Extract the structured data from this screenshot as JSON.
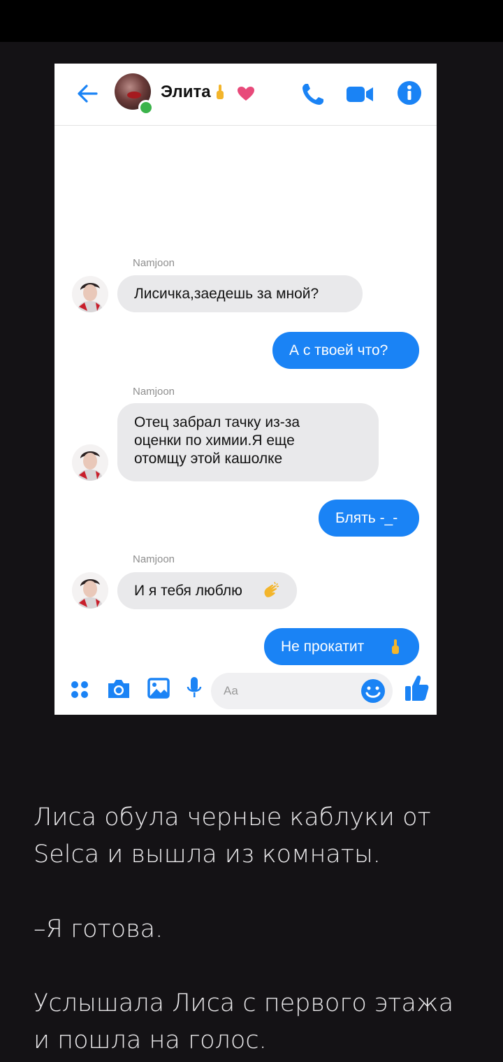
{
  "chat": {
    "contact_name": "Элита",
    "header_icons": [
      "back-arrow-icon",
      "middle-finger-emoji-icon",
      "heart-icon",
      "phone-icon",
      "video-camera-icon",
      "info-icon"
    ],
    "messages": [
      {
        "sender": "Namjoon",
        "text": "Лисичка,заедешь за мной?",
        "direction": "in"
      },
      {
        "text": "А с твоей что?",
        "direction": "out"
      },
      {
        "sender": "Namjoon",
        "lines": [
          "Отец забрал тачку из-за",
          "оценки по химии.Я еще",
          "отомщу этой кашолке"
        ],
        "direction": "in"
      },
      {
        "text": "Блять -_-",
        "direction": "out"
      },
      {
        "sender": "Namjoon",
        "text": "И я тебя люблю",
        "emoji": "clapping-hands-icon",
        "direction": "in"
      },
      {
        "text": "Не прокатит",
        "emoji": "middle-finger-emoji-icon",
        "direction": "out"
      }
    ],
    "composer": {
      "placeholder": "Aa",
      "icons": [
        "menu-dots-icon",
        "camera-icon",
        "gallery-icon",
        "microphone-icon",
        "emoji-icon",
        "thumbs-up-icon"
      ]
    },
    "colors": {
      "accent": "#1a83f5",
      "incoming_bubble": "#e9e9eb",
      "online": "#3bb34a"
    }
  },
  "story": {
    "paragraph1_lines": [
      "Лиса обула черные каблуки от",
      "Selca и вышла из комнаты."
    ],
    "paragraph2": "–Я готова.",
    "paragraph3_lines": [
      "Услышала Лиса с первого этажа",
      "и пошла на голос."
    ]
  },
  "colors": {
    "page_background": "#141215",
    "story_text": "#e9e8ea"
  }
}
